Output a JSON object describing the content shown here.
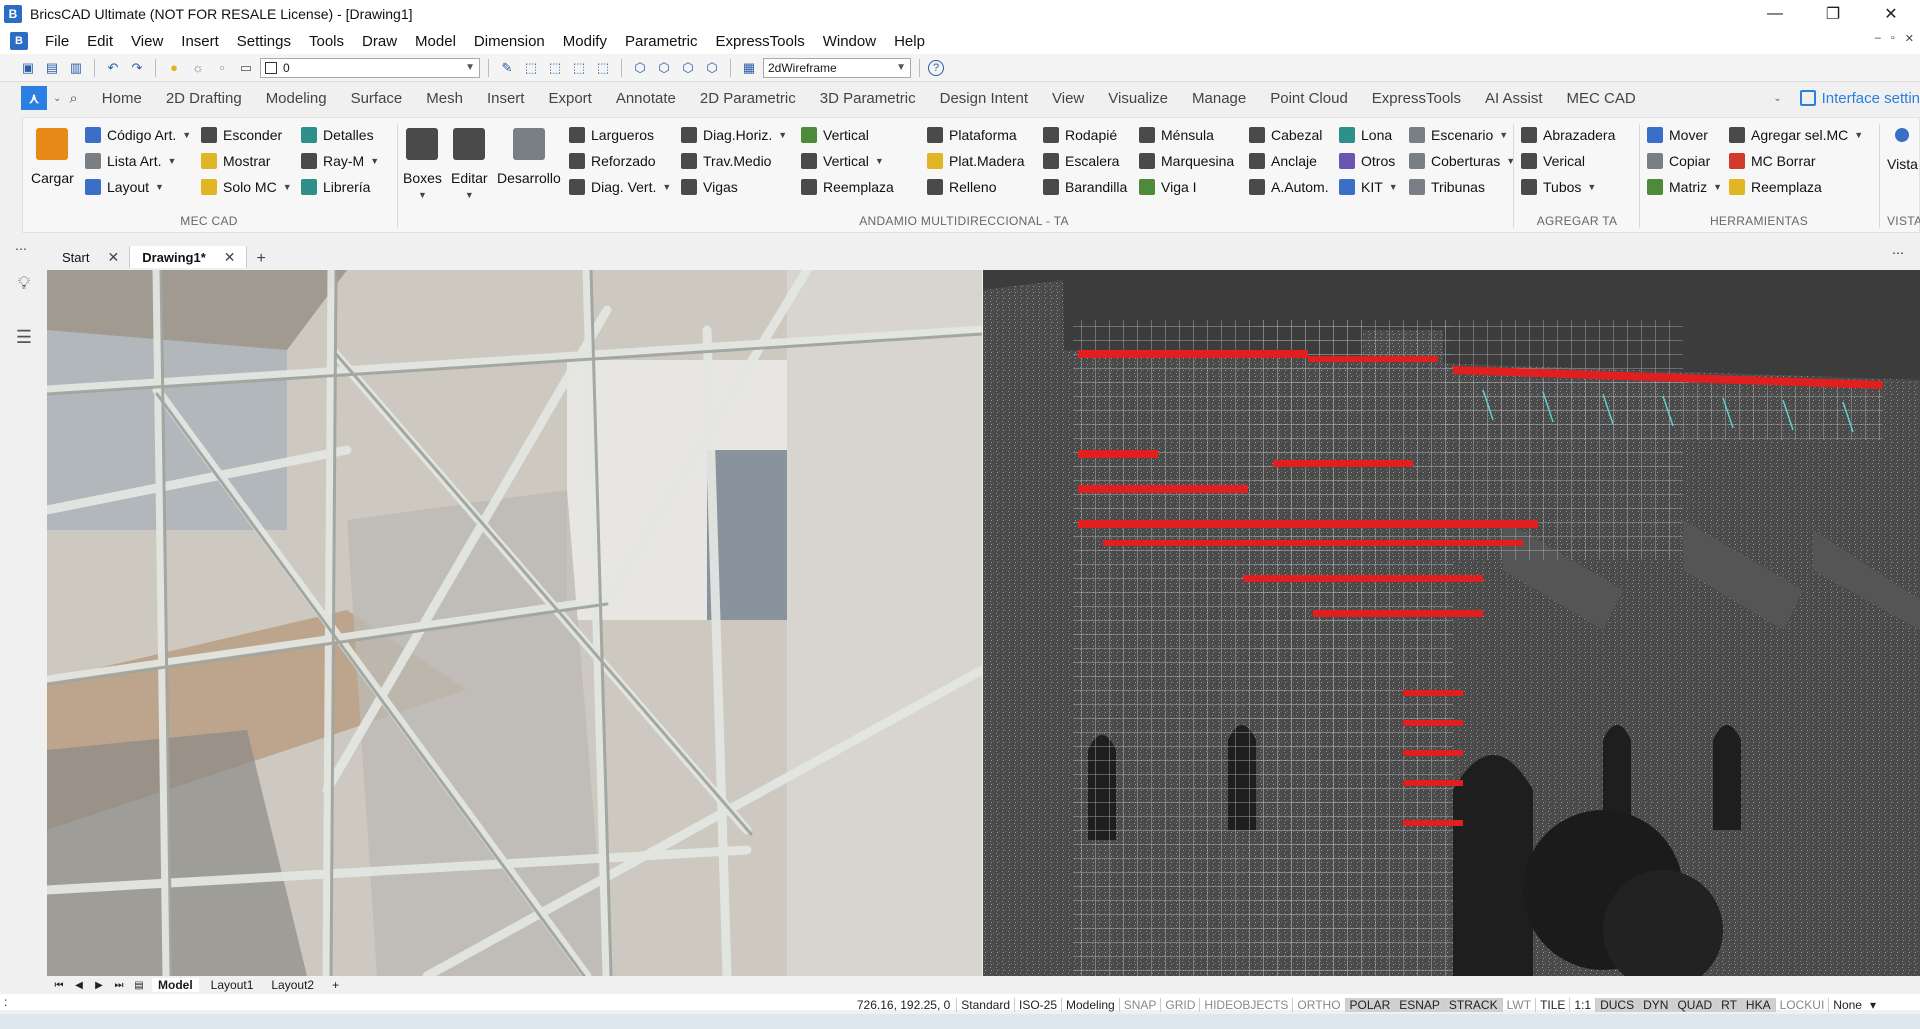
{
  "titlebar": {
    "title": "BricsCAD Ultimate (NOT FOR RESALE License) - [Drawing1]",
    "minimize": "—",
    "maximize": "❐",
    "close": "✕"
  },
  "menubar": {
    "items": [
      "File",
      "Edit",
      "View",
      "Insert",
      "Settings",
      "Tools",
      "Draw",
      "Model",
      "Dimension",
      "Modify",
      "Parametric",
      "ExpressTools",
      "Window",
      "Help"
    ],
    "mdi_min": "–",
    "mdi_restore": "▫",
    "mdi_close": "✕"
  },
  "qat": {
    "layer_value": "0",
    "visual_style_value": "2dWireframe",
    "help_label": "?"
  },
  "ribbon_tabs": {
    "tabs": [
      "Home",
      "2D Drafting",
      "Modeling",
      "Surface",
      "Mesh",
      "Insert",
      "Export",
      "Annotate",
      "2D Parametric",
      "3D Parametric",
      "Design Intent",
      "View",
      "Visualize",
      "Manage",
      "Point Cloud",
      "ExpressTools",
      "AI Assist",
      "MEC CAD"
    ],
    "interface_settings": "Interface settin"
  },
  "ribbon": {
    "mec_cad": {
      "title": "MEC CAD",
      "cargar": "Cargar",
      "col1": [
        "Código Art.",
        "Lista Art.",
        "Layout"
      ],
      "col2": [
        "Esconder",
        "Mostrar",
        "Solo MC"
      ],
      "col3": [
        "Detalles",
        "Ray-M",
        "Librería"
      ]
    },
    "andamio": {
      "title": "ANDAMIO MULTIDIRECCIONAL - TA",
      "boxes": "Boxes",
      "editar": "Editar",
      "desarrollo": "Desarrollo",
      "col1": [
        "Largueros",
        "Reforzado",
        "Diag. Vert."
      ],
      "col2": [
        "Diag.Horiz.",
        "Trav.Medio",
        "Vigas"
      ],
      "col3": [
        "Vertical",
        "Vertical",
        "Reemplaza"
      ],
      "col4": [
        "Plataforma",
        "Plat.Madera",
        "Relleno"
      ],
      "col5": [
        "Rodapié",
        "Escalera",
        "Barandilla"
      ],
      "col6": [
        "Ménsula",
        "Marquesina",
        "Viga I"
      ],
      "col7": [
        "Cabezal",
        "Anclaje",
        "A.Autom."
      ],
      "col8": [
        "Lona",
        "Otros",
        "KIT"
      ],
      "col9": [
        "Escenario",
        "Coberturas",
        "Tribunas"
      ]
    },
    "agregar_ta": {
      "title": "AGREGAR TA",
      "col1": [
        "Abrazadera",
        "Verical",
        "Tubos"
      ]
    },
    "herramientas": {
      "title": "HERRAMIENTAS",
      "col1": [
        "Mover",
        "Copiar",
        "Matriz"
      ],
      "col2": [
        "Agregar sel.MC",
        "MC Borrar",
        "Reemplaza"
      ]
    },
    "vista": {
      "title": "VISTA",
      "label": "Vista"
    }
  },
  "doctabs": {
    "tabs": [
      {
        "label": "Start"
      },
      {
        "label": "Drawing1*"
      }
    ],
    "add": "+",
    "menu": "⋯"
  },
  "layouttabs": {
    "tabs": [
      "Model",
      "Layout1",
      "Layout2"
    ],
    "add": "+"
  },
  "statusbar": {
    "coords": "726.16, 192.25, 0",
    "items": [
      "Standard",
      "ISO-25",
      "Modeling",
      "SNAP",
      "GRID",
      "HIDEOBJECTS",
      "ORTHO",
      "POLAR",
      "ESNAP",
      "STRACK",
      "LWT",
      "TILE",
      "1:1",
      "DUCS",
      "DYN",
      "QUAD",
      "RT",
      "HKA",
      "LOCKUI",
      "None"
    ],
    "active_items": [
      "POLAR",
      "ESNAP",
      "STRACK",
      "DUCS",
      "DYN",
      "QUAD",
      "RT",
      "HKA"
    ]
  },
  "cmdline": {
    "prompt": ":"
  },
  "colors": {
    "accent": "#2b7fe0",
    "scaffold_red": "#e21f1f",
    "pointcloud_bg": "#3c3c3c"
  }
}
